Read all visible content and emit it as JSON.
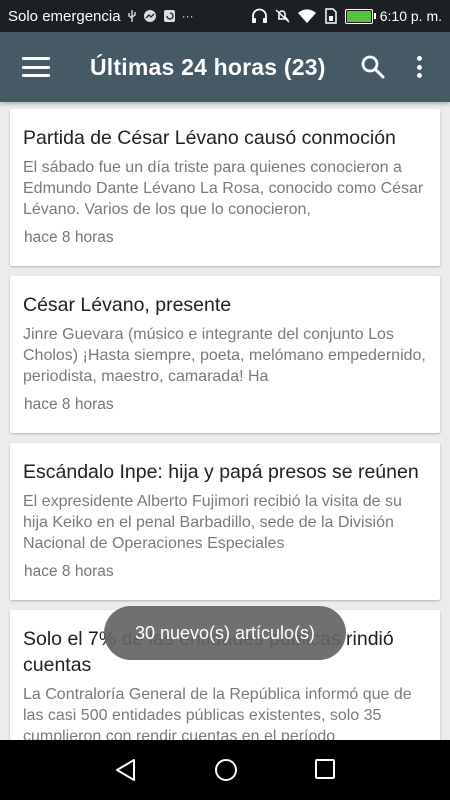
{
  "status_bar": {
    "carrier": "Solo emergencia",
    "time": "6:10 p. m.",
    "battery_level": 1.0,
    "icons": [
      "usb-icon",
      "gallery-icon",
      "sync-icon",
      "more-icon",
      "headphones-icon",
      "mute-icon",
      "wifi-icon",
      "sim-icon",
      "battery-icon"
    ]
  },
  "app_bar": {
    "title": "Últimas 24 horas (23)",
    "menu_icon": "menu-icon",
    "search_icon": "search-icon",
    "overflow_icon": "more-vert-icon"
  },
  "articles": [
    {
      "title": "Partida de César Lévano causó conmoción",
      "snippet": "El sábado fue un día triste para quienes conocieron a Edmundo Dante Lévano La Rosa, conocido como César Lévano. Varios de los que lo conocieron,",
      "time": "hace 8 horas"
    },
    {
      "title": "César Lévano, presente",
      "snippet": "Jinre Guevara (músico e integrante del conjunto Los Cholos) ¡Hasta siempre, poeta, melómano empedernido, periodista, maestro, camarada! Ha",
      "time": "hace 8 horas"
    },
    {
      "title": "Escándalo Inpe: hija y papá presos se reúnen",
      "snippet": "El expresidente Alberto Fujimori recibió la visita de su hija Keiko en el penal Barbadillo, sede de la División Nacional de Operaciones Especiales",
      "time": "hace 8 horas"
    },
    {
      "title": "Solo el 7% de las entidades públicas rindió cuentas",
      "snippet": "La Contraloría General de la República informó que de las casi 500 entidades públicas existentes, solo 35 cumplieron con rendir cuentas en el período",
      "time": ""
    }
  ],
  "toast": "30 nuevo(s) artículo(s)",
  "nav_bar": [
    "back-icon",
    "home-icon",
    "recents-icon"
  ]
}
